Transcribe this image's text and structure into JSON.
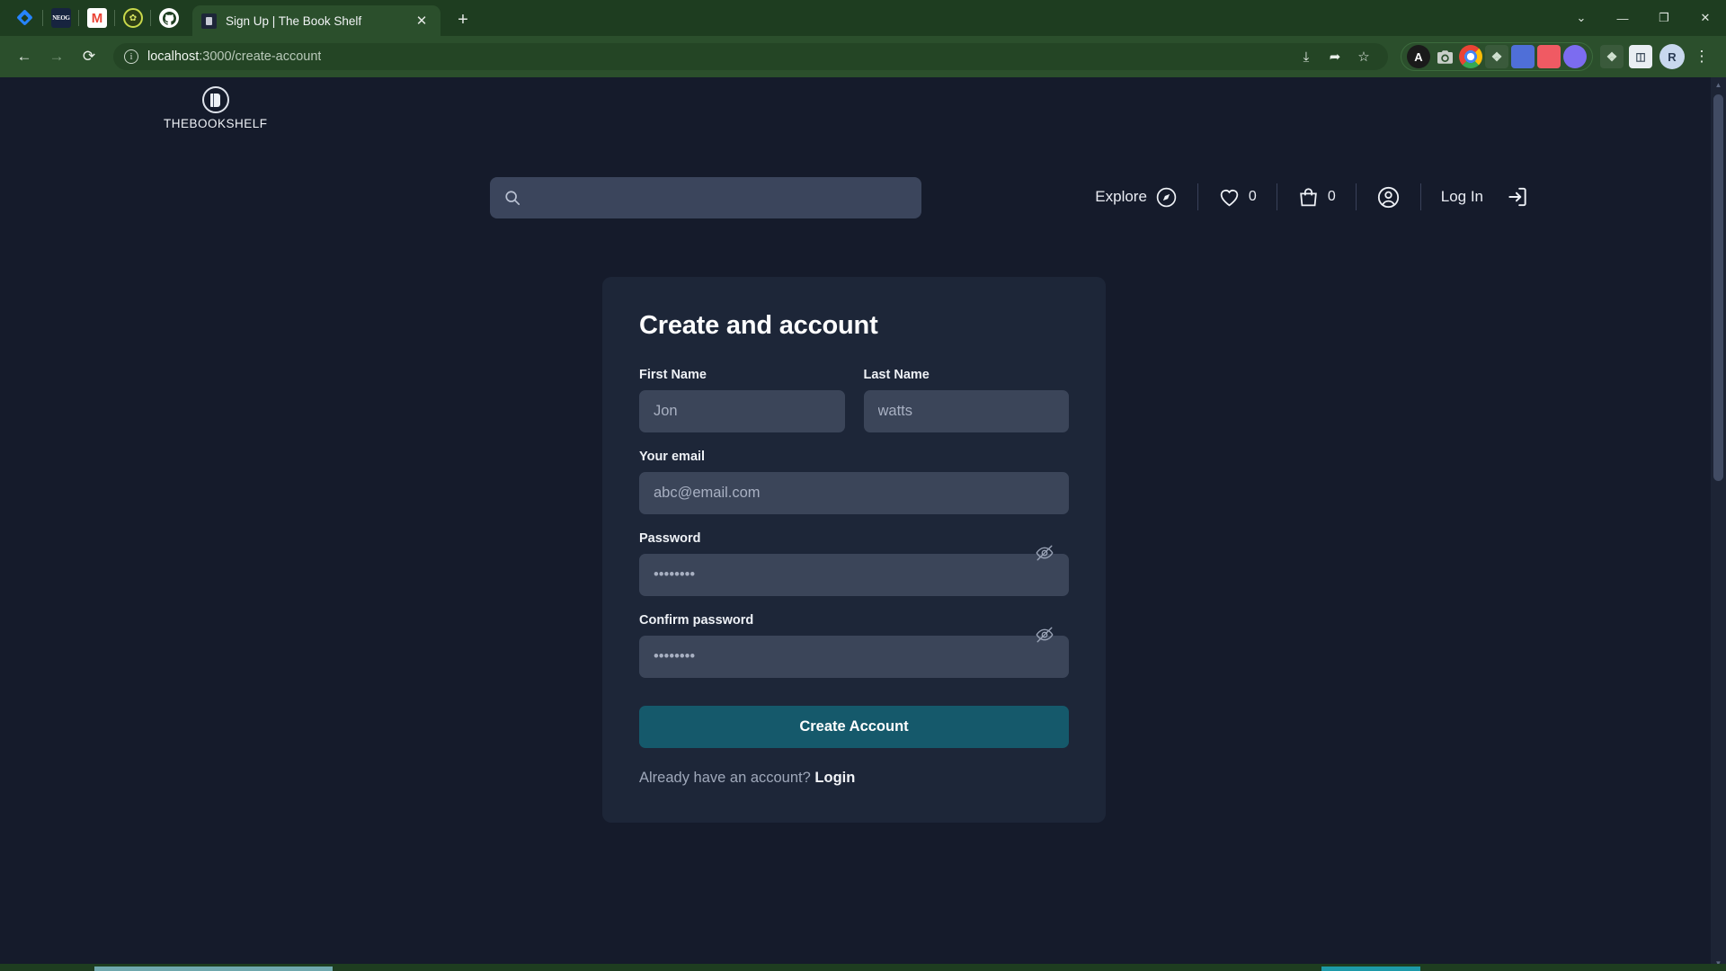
{
  "browser": {
    "pinned_tabs": [
      {
        "name": "jira",
        "label": "Jira"
      },
      {
        "name": "neog",
        "label": "NEOG"
      },
      {
        "name": "gmail",
        "label": "M"
      },
      {
        "name": "bee",
        "label": "✿"
      },
      {
        "name": "github",
        "label": "●"
      }
    ],
    "active_tab": {
      "title": "Sign Up | The Book Shelf",
      "close_label": "✕"
    },
    "new_tab_label": "+",
    "window_controls": {
      "more": "⌄",
      "minimize": "—",
      "maximize": "❐",
      "close": "✕"
    },
    "nav": {
      "back": "←",
      "forward": "→",
      "reload": "⟳"
    },
    "omnibox": {
      "info_icon": "i",
      "url_host": "localhost",
      "url_path": ":3000/create-account",
      "install_icon": "⤓",
      "share_icon": "➦",
      "bookmark_icon": "☆"
    },
    "extensions": [
      {
        "name": "angular-extension",
        "label": "A",
        "cls": "ext-angular"
      },
      {
        "name": "screenshot-extension",
        "label": "◉",
        "cls": "ext-cam"
      },
      {
        "name": "chrome-extension",
        "label": "",
        "cls": "ext-chrome"
      },
      {
        "name": "puzzle-extension",
        "label": "❖",
        "cls": "ext-pz"
      },
      {
        "name": "blue-extension",
        "label": "▮",
        "cls": "ext-blue"
      },
      {
        "name": "pink-extension",
        "label": "◐",
        "cls": "ext-pink"
      },
      {
        "name": "purple-extension",
        "label": "✹",
        "cls": "ext-purple"
      }
    ],
    "toolbar_right": [
      {
        "name": "extensions-puzzle-icon",
        "label": "❖",
        "cls": "ext-pz"
      },
      {
        "name": "sidepanel-icon",
        "label": "◫",
        "cls": "ext-sq"
      }
    ],
    "profile_initial": "R",
    "menu_icon": "⋮"
  },
  "site": {
    "brand": {
      "name": "THEBOOKSHELF"
    },
    "search": {
      "placeholder": "",
      "value": "",
      "icon": "search-icon"
    },
    "nav": {
      "explore_label": "Explore",
      "wishlist_count": "0",
      "cart_count": "0",
      "login_label": "Log In"
    }
  },
  "form": {
    "title": "Create and account",
    "fields": {
      "first_name": {
        "label": "First Name",
        "placeholder": "Jon",
        "value": ""
      },
      "last_name": {
        "label": "Last Name",
        "placeholder": "watts",
        "value": ""
      },
      "email": {
        "label": "Your email",
        "placeholder": "abc@email.com",
        "value": ""
      },
      "password": {
        "label": "Password",
        "placeholder": "••••••••",
        "value": ""
      },
      "confirm_password": {
        "label": "Confirm password",
        "placeholder": "••••••••",
        "value": ""
      }
    },
    "submit_label": "Create Account",
    "footer_text": "Already have an account?",
    "footer_link": "Login"
  },
  "colors": {
    "page_bg": "#151b2b",
    "card_bg": "#1d2638",
    "input_bg": "#3b4559",
    "accent": "#15596b",
    "browser_chrome": "#2b4f2c",
    "tabstrip": "#1e3d20"
  }
}
